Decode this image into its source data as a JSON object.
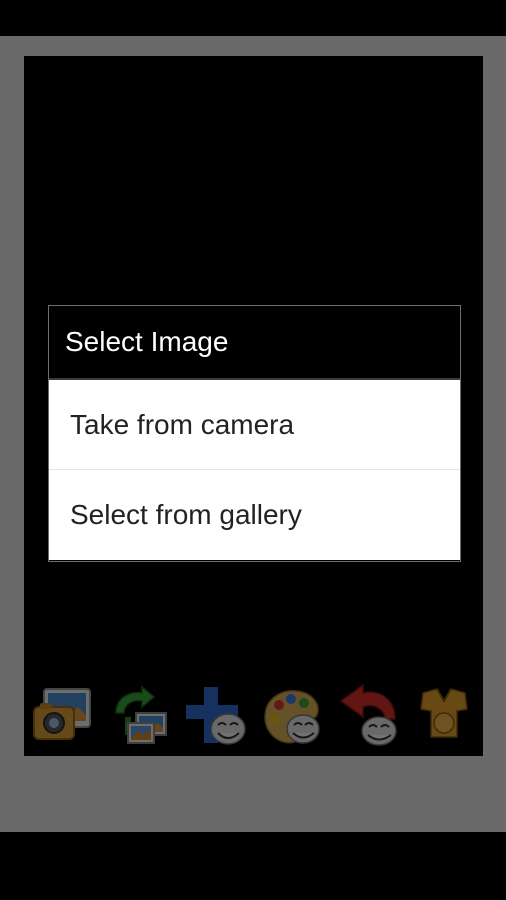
{
  "dialog": {
    "title": "Select Image",
    "options": [
      {
        "label": "Take from camera"
      },
      {
        "label": "Select from gallery"
      }
    ]
  },
  "toolbar": {
    "tools": [
      {
        "icon": "photo-camera-icon"
      },
      {
        "icon": "rotate-images-icon"
      },
      {
        "icon": "add-face-icon"
      },
      {
        "icon": "paint-palette-face-icon"
      },
      {
        "icon": "undo-face-icon"
      },
      {
        "icon": "save-vest-icon"
      }
    ]
  },
  "colors": {
    "app_background": "#eaeaea",
    "canvas": "#000000",
    "dialog_title_bg": "#000000",
    "dialog_option_bg": "#ffffff",
    "dialog_border": "#6d6d6d"
  }
}
